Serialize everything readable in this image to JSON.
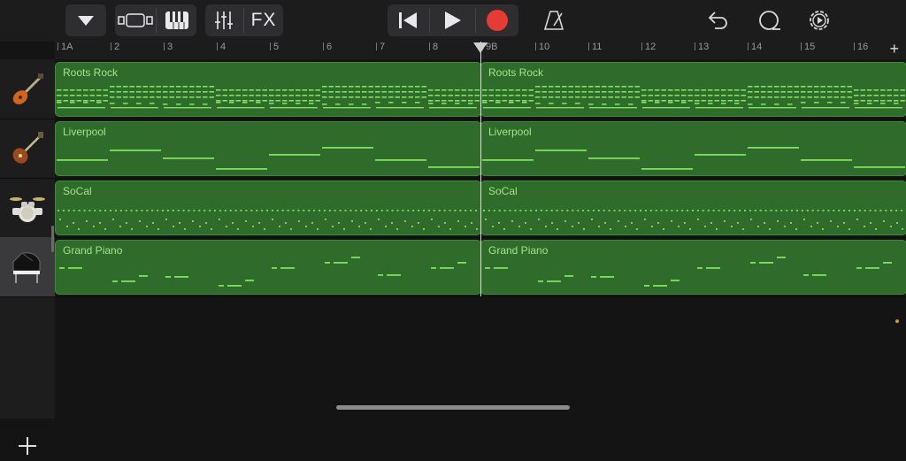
{
  "toolbar": {
    "fx_label": "FX",
    "icons": [
      "menu-triangle-icon",
      "track-view-icon",
      "keyboard-icon",
      "mixer-icon",
      "fx",
      "rewind-icon",
      "play-icon",
      "record-icon",
      "metronome-icon",
      "undo-icon",
      "loop-browser-icon",
      "settings-icon"
    ],
    "record_color": "#e63a35"
  },
  "ruler": {
    "bars": [
      "1A",
      "2",
      "3",
      "4",
      "5",
      "6",
      "7",
      "8",
      "9B",
      "10",
      "11",
      "12",
      "13",
      "14",
      "15",
      "16"
    ],
    "add_label": "+"
  },
  "tracks": [
    {
      "instrument": "electric-guitar-icon",
      "region": "Roots Rock"
    },
    {
      "instrument": "bass-guitar-icon",
      "region": "Liverpool"
    },
    {
      "instrument": "drum-kit-icon",
      "region": "SoCal"
    },
    {
      "instrument": "grand-piano-icon",
      "region": "Grand Piano"
    }
  ],
  "add_track_label": "+",
  "colors": {
    "region_fill": "#2f6b2a",
    "region_note": "#7fe25f",
    "accent": "#e0922b"
  }
}
